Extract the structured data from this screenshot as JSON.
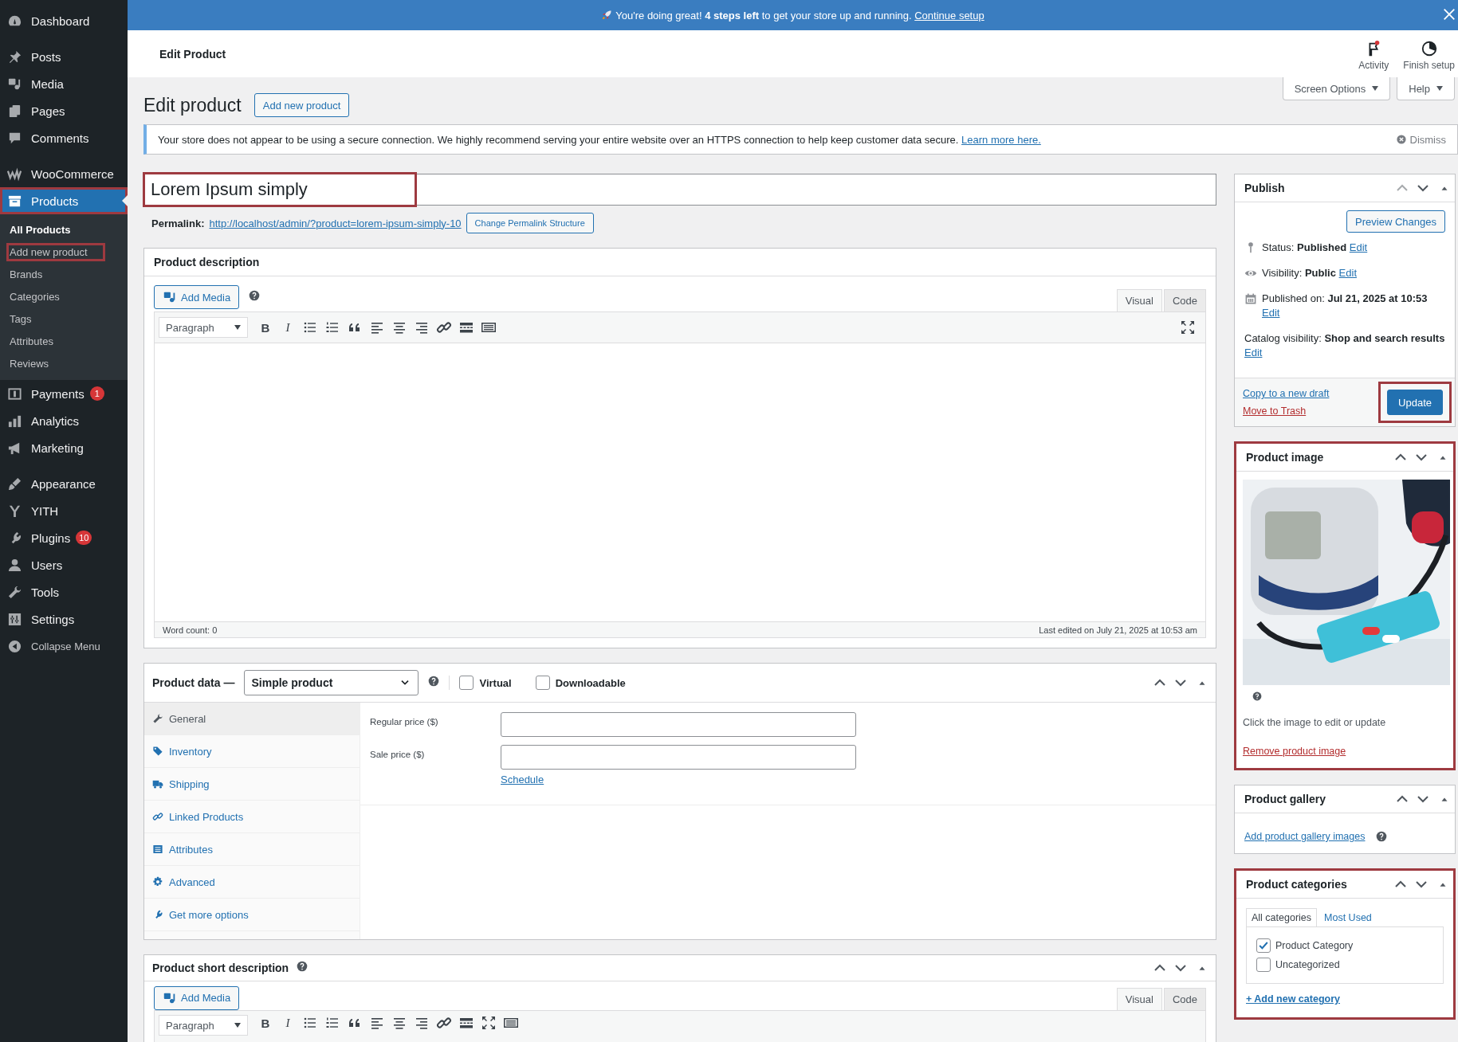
{
  "top_banner": {
    "text": "You're doing great! **4 steps left** to get your store up and running.",
    "link": "Continue setup"
  },
  "header": {
    "title": "Edit Product",
    "actions": [
      {
        "label": "Activity",
        "kind": "activity"
      },
      {
        "label": "Finish setup",
        "kind": "setup"
      }
    ]
  },
  "sidebar": {
    "groups": [
      {
        "items": [
          {
            "label": "Dashboard",
            "kind": "dashboard",
            "selected": false
          }
        ]
      },
      {
        "items": [
          {
            "label": "Posts",
            "kind": "posts",
            "selected": false
          },
          {
            "label": "Media",
            "kind": "media",
            "selected": false
          },
          {
            "label": "Pages",
            "kind": "pages",
            "selected": false
          },
          {
            "label": "Comments",
            "kind": "comments",
            "selected": false
          }
        ]
      },
      {
        "items": [
          {
            "label": "WooCommerce",
            "kind": "woo",
            "selected": false
          },
          {
            "label": "Products",
            "kind": "products",
            "selected": true,
            "highlighted": true,
            "children": [
              {
                "label": "All Products",
                "selected": true,
                "highlighted": false
              },
              {
                "label": "Add new product",
                "selected": false,
                "highlighted": true
              },
              {
                "label": "Brands",
                "selected": false,
                "highlighted": false
              },
              {
                "label": "Categories",
                "selected": false,
                "highlighted": false
              },
              {
                "label": "Tags",
                "selected": false,
                "highlighted": false
              },
              {
                "label": "Attributes",
                "selected": false,
                "highlighted": false
              },
              {
                "label": "Reviews",
                "selected": false,
                "highlighted": false
              }
            ]
          },
          {
            "label": "Payments",
            "kind": "payments",
            "selected": false,
            "badge": "1"
          },
          {
            "label": "Analytics",
            "kind": "analytics",
            "selected": false
          },
          {
            "label": "Marketing",
            "kind": "marketing",
            "selected": false
          }
        ]
      },
      {
        "items": [
          {
            "label": "Appearance",
            "kind": "appearance",
            "selected": false
          },
          {
            "label": "YITH",
            "kind": "yith",
            "selected": false
          },
          {
            "label": "Plugins",
            "kind": "plugins",
            "selected": false,
            "badge": "10"
          },
          {
            "label": "Users",
            "kind": "users",
            "selected": false
          },
          {
            "label": "Tools",
            "kind": "tools",
            "selected": false
          },
          {
            "label": "Settings",
            "kind": "settings",
            "selected": false
          },
          {
            "label": "Collapse Menu",
            "kind": "collapse",
            "selected": false
          }
        ]
      }
    ]
  },
  "page_title": "Edit product",
  "add_new_button": "Add new product",
  "screen_options": "Screen Options",
  "help": "Help",
  "notice": {
    "text": "Your store does not appear to be using a secure connection. We highly recommend serving your entire website over an HTTPS connection to help keep customer data secure.",
    "link": "Learn more here.",
    "dismiss": "Dismiss"
  },
  "title_field": {
    "value": "Lorem Ipsum simply",
    "highlighted": true
  },
  "permalink": {
    "label": "Permalink:",
    "url": "http://localhost/admin/?product=lorem-ipsum-simply-10",
    "button": "Change Permalink Structure"
  },
  "description": {
    "title": "Product description",
    "add_media": "Add Media",
    "tabs": [
      {
        "label": "Visual",
        "selected": true
      },
      {
        "label": "Code",
        "selected": false
      }
    ],
    "format": "Paragraph",
    "toolbar": [
      {
        "kind": "bold",
        "label": "B"
      },
      {
        "kind": "italic",
        "label": "I"
      },
      {
        "kind": "bullets"
      },
      {
        "kind": "numbers"
      },
      {
        "kind": "quote"
      },
      {
        "kind": "align-left"
      },
      {
        "kind": "align-center"
      },
      {
        "kind": "align-right"
      },
      {
        "kind": "link"
      },
      {
        "kind": "more"
      },
      {
        "kind": "kitchen"
      }
    ],
    "right_tools": [
      {
        "kind": "fullscreen"
      }
    ],
    "word_count": "Word count: 0",
    "last_edited": "Last edited on July 21, 2025 at 10:53 am"
  },
  "product_data": {
    "title": "Product data —",
    "type": "Simple product",
    "options": [
      {
        "label": "Virtual",
        "checked": false
      },
      {
        "label": "Downloadable",
        "checked": false
      }
    ],
    "tabs": [
      {
        "label": "General",
        "kind": "wrench",
        "selected": true
      },
      {
        "label": "Inventory",
        "kind": "tag",
        "selected": false
      },
      {
        "label": "Shipping",
        "kind": "truck",
        "selected": false
      },
      {
        "label": "Linked Products",
        "kind": "link",
        "selected": false
      },
      {
        "label": "Attributes",
        "kind": "list",
        "selected": false
      },
      {
        "label": "Advanced",
        "kind": "gear",
        "selected": false
      },
      {
        "label": "Get more options",
        "kind": "plugins",
        "selected": false
      }
    ],
    "fields": [
      {
        "label": "Regular price ($)"
      },
      {
        "label": "Sale price ($)",
        "link": "Schedule"
      }
    ]
  },
  "short_description": {
    "title": "Product short description",
    "add_media": "Add Media",
    "tabs": [
      {
        "label": "Visual",
        "selected": true
      },
      {
        "label": "Code",
        "selected": false
      }
    ],
    "format": "Paragraph",
    "toolbar": [
      {
        "kind": "bold",
        "label": "B"
      },
      {
        "kind": "italic",
        "label": "I"
      },
      {
        "kind": "bullets"
      },
      {
        "kind": "numbers"
      },
      {
        "kind": "quote"
      },
      {
        "kind": "align-left"
      },
      {
        "kind": "align-center"
      },
      {
        "kind": "align-right"
      },
      {
        "kind": "link"
      },
      {
        "kind": "more"
      },
      {
        "kind": "fullscreen"
      },
      {
        "kind": "kitchen"
      }
    ]
  },
  "publish": {
    "title": "Publish",
    "preview": "Preview Changes",
    "rows": [
      {
        "kind": "status",
        "label": "Status:",
        "value": "Published",
        "link": "Edit"
      },
      {
        "kind": "visibility",
        "label": "Visibility:",
        "value": "Public",
        "link": "Edit"
      },
      {
        "kind": "date",
        "label": "Published on:",
        "value": "Jul 21, 2025 at 10:53",
        "link": "Edit"
      },
      {
        "kind": "plain",
        "label": "Catalog visibility:",
        "value": "Shop and search results",
        "link": "Edit"
      }
    ],
    "copy": "Copy to a new draft",
    "trash": "Move to Trash",
    "update": {
      "label": "Update",
      "highlighted": true
    }
  },
  "product_image": {
    "title": "Product image",
    "highlighted": true,
    "hint": "Click the image to edit or update",
    "remove": "Remove product image"
  },
  "gallery": {
    "title": "Product gallery",
    "highlighted": false,
    "link": "Add product gallery images"
  },
  "categories": {
    "title": "Product categories",
    "highlighted": true,
    "tabs": [
      {
        "label": "All categories",
        "selected": true
      },
      {
        "label": "Most Used",
        "selected": false
      }
    ],
    "items": [
      {
        "label": "Product Category",
        "checked": true
      },
      {
        "label": "Uncategorized",
        "checked": false
      }
    ],
    "add": "+ Add new category"
  }
}
